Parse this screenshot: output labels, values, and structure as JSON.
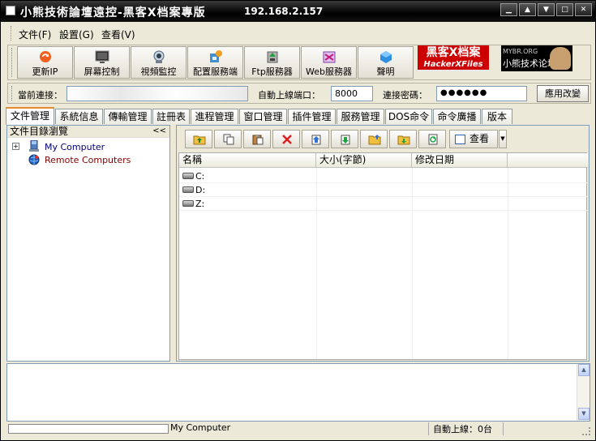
{
  "window": {
    "title": "小熊技術論壇遠控-黑客X档案專版",
    "ip": "192.168.2.157",
    "controls": [
      "▁",
      "▲",
      "▼",
      "□",
      "✕"
    ]
  },
  "menu": [
    "文件(F)",
    "設置(G)",
    "查看(V)"
  ],
  "toolbar": [
    {
      "label": "更新IP",
      "icon": "refresh-ip-icon",
      "color": "#e05010"
    },
    {
      "label": "屏幕控制",
      "icon": "screen-icon",
      "color": "#303030"
    },
    {
      "label": "視頻監控",
      "icon": "webcam-icon",
      "color": "#6080a0"
    },
    {
      "label": "配置服務端",
      "icon": "config-server-icon",
      "color": "#3080c0"
    },
    {
      "label": "Ftp服務器",
      "icon": "ftp-icon",
      "color": "#808080"
    },
    {
      "label": "Web服務器",
      "icon": "web-server-icon",
      "color": "#a040c0"
    },
    {
      "label": "聲明",
      "icon": "info-cube-icon",
      "color": "#2070d0"
    }
  ],
  "logos": {
    "hacker_top": "黑客X档案",
    "hacker_bottom": "HackerXFiles",
    "forum_top": "MYBR.ORG",
    "forum_bottom": "小熊技术论坛"
  },
  "connection": {
    "current_label": "當前連接：",
    "port_label": "自動上線端口：",
    "port_value": "8000",
    "password_label": "連接密碼：",
    "password_value": "●●●●●●",
    "apply_label": "應用改變"
  },
  "tabs": [
    "文件管理",
    "系統信息",
    "傳輸管理",
    "註冊表",
    "進程管理",
    "窗口管理",
    "插件管理",
    "服務管理",
    "DOS命令",
    "命令廣播",
    "版本"
  ],
  "active_tab": 0,
  "left_panel": {
    "title": "文件目錄瀏覽",
    "collapse": "<<",
    "tree": [
      {
        "label": "My Computer",
        "expander": "+",
        "color": "#000080"
      },
      {
        "label": "Remote Computers",
        "expander": "",
        "color": "#800000"
      }
    ]
  },
  "file_toolbar": {
    "buttons": [
      "up-folder-icon",
      "copy-icon",
      "paste-icon",
      "delete-icon",
      "upload-icon",
      "download-icon",
      "open-folder-icon",
      "save-icon",
      "refresh-icon"
    ],
    "view_label": "查看",
    "dropdown": "▼"
  },
  "file_list": {
    "columns": [
      "名稱",
      "大小(字節)",
      "修改日期",
      ""
    ],
    "rows": [
      {
        "name": "C:",
        "size": "",
        "date": ""
      },
      {
        "name": "D:",
        "size": "",
        "date": ""
      },
      {
        "name": "Z:",
        "size": "",
        "date": ""
      }
    ]
  },
  "log_panel": {
    "scroll_up": "▲",
    "scroll_down": "▼"
  },
  "status": {
    "path": "My Computer",
    "online": "自動上線：0台"
  }
}
